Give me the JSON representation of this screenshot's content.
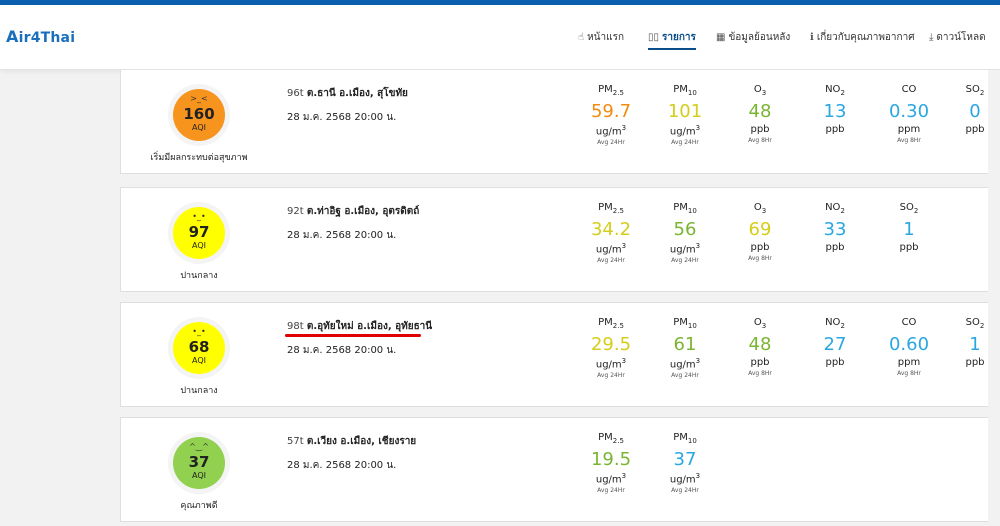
{
  "logo": {
    "text": "ir4Thai",
    "first": "A"
  },
  "nav": [
    {
      "label": "หน้าแรก",
      "icon": "hand-icon"
    },
    {
      "label": "รายการ",
      "icon": "list-icon",
      "active": true
    },
    {
      "label": "ข้อมูลย้อนหลัง",
      "icon": "table-icon"
    },
    {
      "label": "เกี่ยวกับคุณภาพอากาศ",
      "icon": "info-icon"
    },
    {
      "label": "ดาวน์โหลด",
      "icon": "download-icon"
    }
  ],
  "pollutants": {
    "pm25": {
      "base": "PM",
      "sub": "2.5"
    },
    "pm10": {
      "base": "PM",
      "sub": "10"
    },
    "o3": {
      "base": "O",
      "sub": "3"
    },
    "no2": {
      "base": "NO",
      "sub": "2"
    },
    "co": {
      "base": "CO",
      "sub": ""
    },
    "so2": {
      "base": "SO",
      "sub": "2"
    }
  },
  "units": {
    "ugm3": "ug/m",
    "ugm3_sup": "3",
    "ppb": "ppb",
    "ppm": "ppm"
  },
  "avg": {
    "h24": "Avg 24Hr",
    "h8": "Avg 8Hr"
  },
  "colors": {
    "orange": "#f28c0f",
    "yellow": "#d4cd19",
    "green": "#7ab532",
    "blue": "#2aa7e0",
    "aqi_orange": "#f7941d",
    "aqi_yellow": "#ffff00",
    "aqi_green": "#92d050"
  },
  "stations": [
    {
      "code": "96t",
      "name": "ต.ธานี อ.เมือง, สุโขทัย",
      "datetime": "28 ม.ค. 2568 20:00 น.",
      "aqi": "160",
      "aqi_label": "AQI",
      "status": "เริ่มมีผลกระทบต่อสุขภาพ",
      "face": ">_<",
      "pm25": "59.7",
      "pm10": "101",
      "o3": "48",
      "no2": "13",
      "co": "0.30",
      "so2": "0"
    },
    {
      "code": "92t",
      "name": "ต.ท่าอิฐ อ.เมือง, อุตรดิตถ์",
      "datetime": "28 ม.ค. 2568 20:00 น.",
      "aqi": "97",
      "aqi_label": "AQI",
      "status": "ปานกลาง",
      "face": "•_•",
      "pm25": "34.2",
      "pm10": "56",
      "o3": "69",
      "no2": "33",
      "so2": "1"
    },
    {
      "code": "98t",
      "name": "ต.อุทัยใหม่ อ.เมือง, อุทัยธานี",
      "datetime": "28 ม.ค. 2568 20:00 น.",
      "aqi": "68",
      "aqi_label": "AQI",
      "status": "ปานกลาง",
      "face": "•_•",
      "pm25": "29.5",
      "pm10": "61",
      "o3": "48",
      "no2": "27",
      "co": "0.60",
      "so2": "1"
    },
    {
      "code": "57t",
      "name": "ต.เวียง อ.เมือง, เชียงราย",
      "datetime": "28 ม.ค. 2568 20:00 น.",
      "aqi": "37",
      "aqi_label": "AQI",
      "status": "คุณภาพดี",
      "face": "^‿^",
      "pm25": "19.5",
      "pm10": "37"
    }
  ]
}
